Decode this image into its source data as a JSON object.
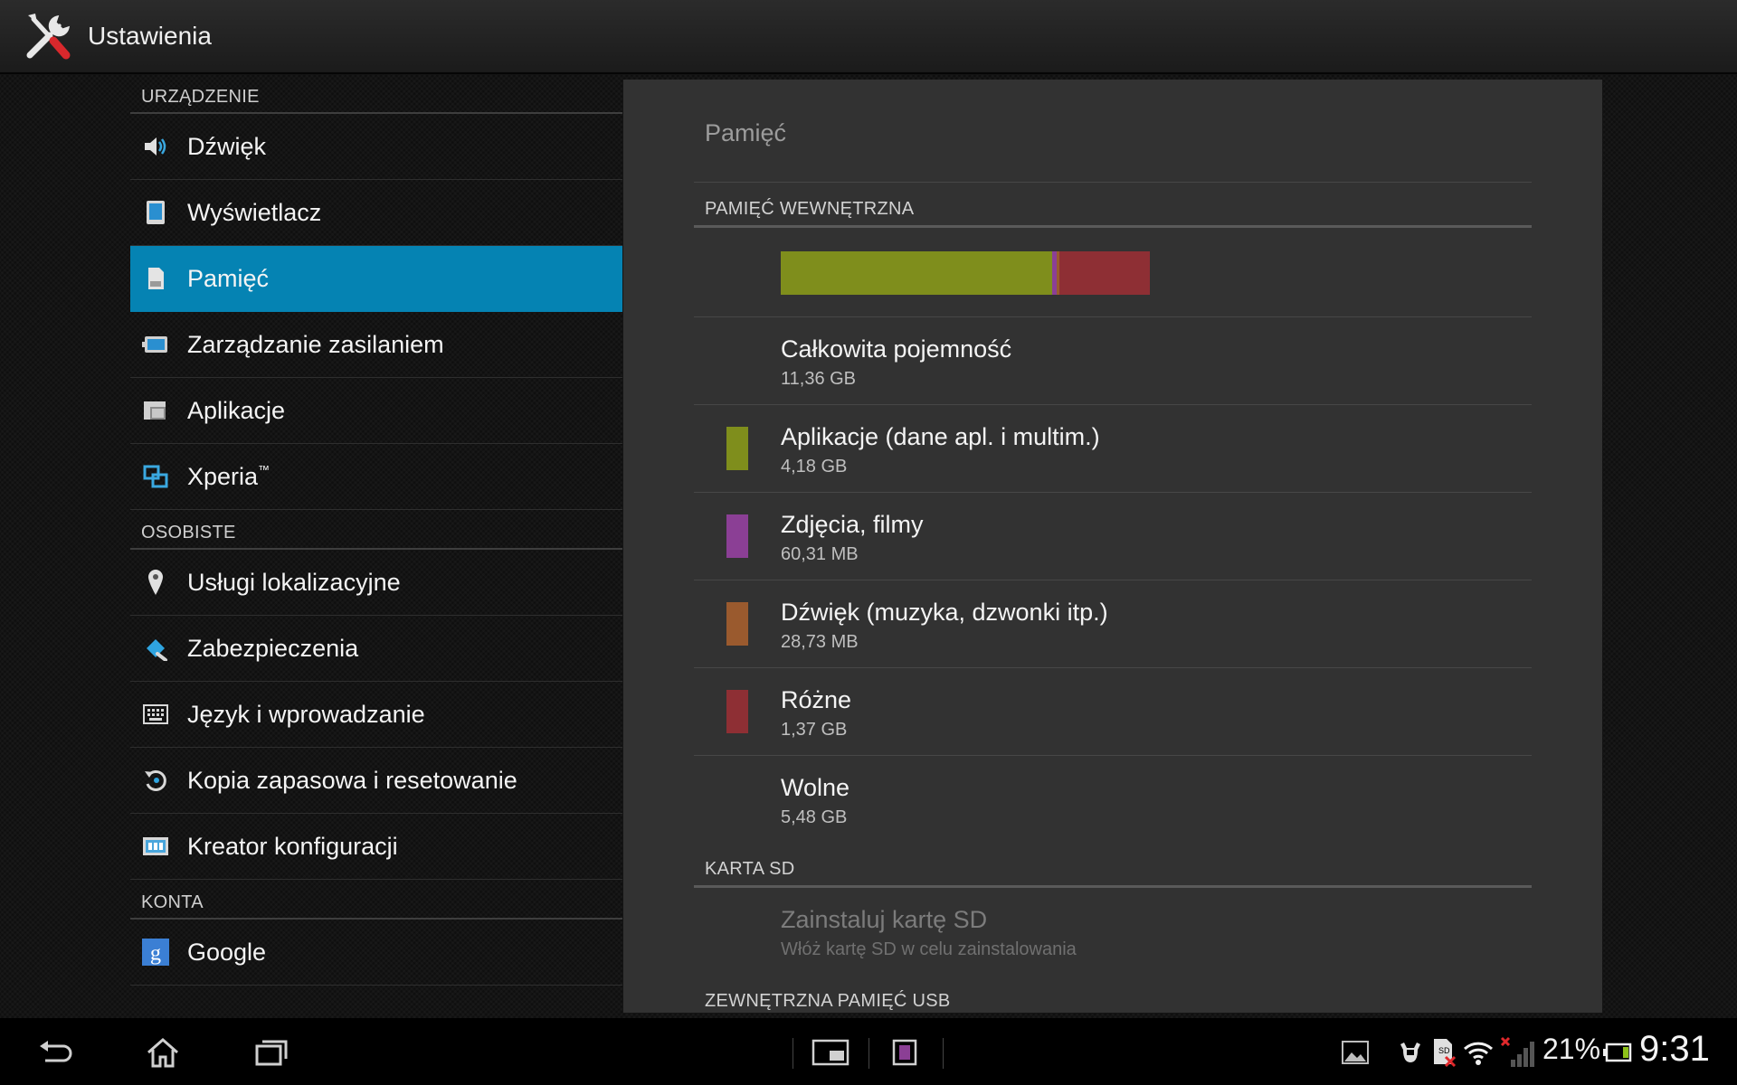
{
  "header": {
    "title": "Ustawienia",
    "icon": "settings-tools-icon"
  },
  "sidebar": {
    "section_device": "URZĄDZENIE",
    "section_personal": "OSOBISTE",
    "section_accounts": "KONTA",
    "items": [
      {
        "label": "Dźwięk",
        "icon": "speaker-icon"
      },
      {
        "label": "Wyświetlacz",
        "icon": "display-icon"
      },
      {
        "label": "Pamięć",
        "icon": "storage-icon",
        "selected": true
      },
      {
        "label": "Zarządzanie zasilaniem",
        "icon": "battery-icon"
      },
      {
        "label": "Aplikacje",
        "icon": "apps-icon"
      },
      {
        "label": "Xperia",
        "tm": "™",
        "icon": "xperia-icon"
      },
      {
        "label": "Usługi lokalizacyjne",
        "icon": "location-pin-icon"
      },
      {
        "label": "Zabezpieczenia",
        "icon": "lock-icon"
      },
      {
        "label": "Język i wprowadzanie",
        "icon": "keyboard-icon"
      },
      {
        "label": "Kopia zapasowa i resetowanie",
        "icon": "backup-restore-icon"
      },
      {
        "label": "Kreator konfiguracji",
        "icon": "setup-wizard-icon"
      },
      {
        "label": "Google",
        "icon": "google-icon"
      }
    ]
  },
  "panel": {
    "title": "Pamięć",
    "internal_header": "PAMIĘĆ WEWNĘTRZNA",
    "usage_bar": [
      {
        "name": "apps",
        "fraction": 0.72,
        "color": "#7f8e1c"
      },
      {
        "name": "photos",
        "fraction": 0.012,
        "color": "#8b3f95"
      },
      {
        "name": "audio",
        "fraction": 0.008,
        "color": "#9a5a2e"
      },
      {
        "name": "misc",
        "fraction": 0.24,
        "color": "#8e2f34"
      }
    ],
    "total": {
      "label": "Całkowita pojemność",
      "value": "11,36 GB"
    },
    "rows": [
      {
        "label": "Aplikacje (dane apl. i multim.)",
        "value": "4,18 GB",
        "color": "#7f8e1c"
      },
      {
        "label": "Zdjęcia, filmy",
        "value": "60,31 MB",
        "color": "#8b3f95"
      },
      {
        "label": "Dźwięk (muzyka, dzwonki itp.)",
        "value": "28,73 MB",
        "color": "#9a5a2e"
      },
      {
        "label": "Różne",
        "value": "1,37 GB",
        "color": "#8e2f34"
      }
    ],
    "free": {
      "label": "Wolne",
      "value": "5,48 GB"
    },
    "sd_header": "KARTA SD",
    "sd_mount": {
      "label": "Zainstaluj kartę SD",
      "value": "Włóż kartę SD w celu zainstalowania"
    },
    "usb_header": "ZEWNĘTRZNA PAMIĘĆ USB"
  },
  "statusbar": {
    "battery_percent": "21%",
    "time": "9:31"
  },
  "colors": {
    "accent": "#0583b3"
  }
}
